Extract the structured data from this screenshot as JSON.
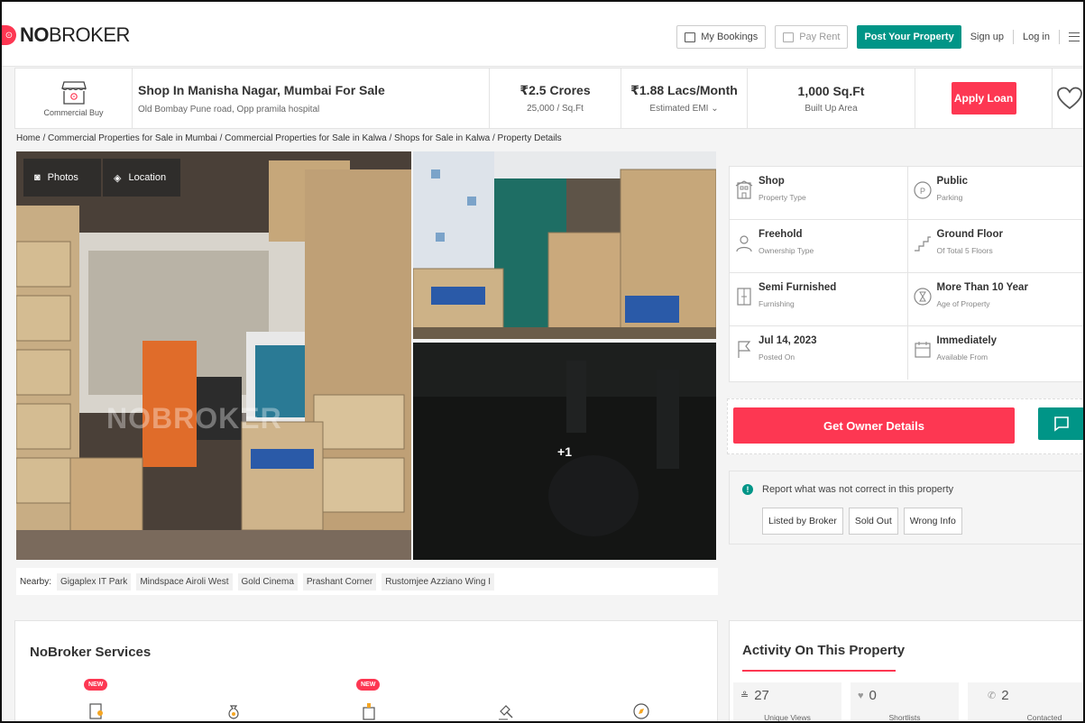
{
  "header": {
    "logo_bold": "NO",
    "logo_rest": "BROKER",
    "my_bookings": "My Bookings",
    "pay_rent": "Pay Rent",
    "post_property": "Post Your Property",
    "sign_up": "Sign up",
    "log_in": "Log in"
  },
  "summary": {
    "type_label": "Commercial Buy",
    "title": "Shop In Manisha Nagar, Mumbai For Sale",
    "address": "Old Bombay Pune road, Opp pramila hospital",
    "price": "₹2.5 Crores",
    "price_per_sqft": "25,000 / Sq.Ft",
    "emi": "₹1.88 Lacs/Month",
    "emi_label": "Estimated EMI ⌄",
    "area": "1,000 Sq.Ft",
    "area_label": "Built Up Area",
    "apply_loan": "Apply Loan"
  },
  "breadcrumb": "Home / Commercial Properties for Sale in Mumbai / Commercial Properties for Sale in Kalwa / Shops for Sale in Kalwa / Property Details",
  "gallery": {
    "photos_btn": "Photos",
    "location_btn": "Location",
    "more_count": "+1",
    "watermark": "NOBROKER"
  },
  "nearby": {
    "label": "Nearby:",
    "places": [
      "Gigaplex IT Park",
      "Mindspace Airoli West",
      "Gold Cinema",
      "Prashant Corner",
      "Rustomjee Azziano Wing I"
    ]
  },
  "details": {
    "rows": [
      [
        {
          "value": "Shop",
          "label": "Property Type",
          "icon": "building-icon"
        },
        {
          "value": "Public",
          "label": "Parking",
          "icon": "parking-icon"
        }
      ],
      [
        {
          "value": "Freehold",
          "label": "Ownership Type",
          "icon": "owner-icon"
        },
        {
          "value": "Ground Floor",
          "label": "Of Total 5 Floors",
          "icon": "stairs-icon"
        }
      ],
      [
        {
          "value": "Semi Furnished",
          "label": "Furnishing",
          "icon": "furnishing-icon"
        },
        {
          "value": "More Than 10 Year",
          "label": "Age of Property",
          "icon": "hourglass-icon"
        }
      ],
      [
        {
          "value": "Jul 14, 2023",
          "label": "Posted On",
          "icon": "flag-icon"
        },
        {
          "value": "Immediately",
          "label": "Available From",
          "icon": "calendar-icon"
        }
      ]
    ]
  },
  "owner": {
    "btn": "Get Owner Details"
  },
  "report": {
    "text": "Report what was not correct in this property",
    "options": [
      "Listed by Broker",
      "Sold Out",
      "Wrong Info"
    ]
  },
  "services": {
    "title": "NoBroker Services",
    "new_badge": "NEW"
  },
  "activity": {
    "title": "Activity On This Property",
    "stats": [
      {
        "value": "27",
        "label": "Unique Views"
      },
      {
        "value": "0",
        "label": "Shortlists"
      },
      {
        "value": "2",
        "label": "Contacted"
      }
    ]
  },
  "colors": {
    "brand_red": "#fd3752",
    "brand_teal": "#009587"
  }
}
